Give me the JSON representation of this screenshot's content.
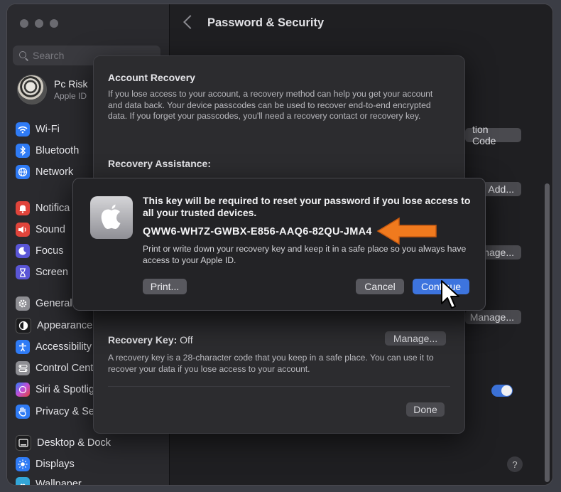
{
  "sidebar": {
    "search_placeholder": "Search",
    "account": {
      "name": "Pc Risk",
      "subtitle": "Apple ID"
    },
    "items": [
      {
        "label": "Wi-Fi",
        "icon": "wifi-icon",
        "color": "#2f7bf5"
      },
      {
        "label": "Bluetooth",
        "icon": "bluetooth-icon",
        "color": "#2f7bf5"
      },
      {
        "label": "Network",
        "icon": "network-icon",
        "color": "#2f7bf5"
      },
      {
        "label": "Notifica",
        "icon": "notifications-icon",
        "color": "#e0443b"
      },
      {
        "label": "Sound",
        "icon": "sound-icon",
        "color": "#e0443b"
      },
      {
        "label": "Focus",
        "icon": "focus-icon",
        "color": "#5a56d6"
      },
      {
        "label": "Screen",
        "icon": "screen-time-icon",
        "color": "#5a56d6"
      },
      {
        "label": "General",
        "icon": "general-icon",
        "color": "#8e8e93"
      },
      {
        "label": "Appearance",
        "icon": "appearance-icon",
        "color": "#1c1c1e"
      },
      {
        "label": "Accessibility",
        "icon": "accessibility-icon",
        "color": "#2f7bf5"
      },
      {
        "label": "Control Cent",
        "icon": "control-center-icon",
        "color": "#8e8e93"
      },
      {
        "label": "Siri & Spotlig",
        "icon": "siri-icon",
        "color": "#c04fd8"
      },
      {
        "label": "Privacy & Se",
        "icon": "privacy-icon",
        "color": "#2f7bf5"
      },
      {
        "label": "Desktop & Dock",
        "icon": "desktop-dock-icon",
        "color": "#1c1c1e"
      },
      {
        "label": "Displays",
        "icon": "displays-icon",
        "color": "#2f7bf5"
      },
      {
        "label": "Wallpaper",
        "icon": "wallpaper-icon",
        "color": "#33a6d8"
      }
    ]
  },
  "main": {
    "title": "Password & Security",
    "bg_buttons": [
      "tion Code",
      "Add...",
      "nage...",
      "Manage..."
    ],
    "help": "?"
  },
  "sheet": {
    "title": "Account Recovery",
    "description": "If you lose access to your account, a recovery method can help you get your account and data back. Your device passcodes can be used to recover end-to-end encrypted data. If you forget your passcodes, you'll need a recovery contact or recovery key.",
    "assistance_label": "Recovery Assistance:",
    "recovery_key_label": "Recovery Key:",
    "recovery_key_value": " Off",
    "recovery_key_desc": "A recovery key is a 28-character code that you keep in a safe place. You can use it to recover your data if you lose access to your account.",
    "manage_label": "Manage...",
    "done_label": "Done"
  },
  "dialog": {
    "title": "This key will be required to reset your password if you lose access to all your trusted devices.",
    "key": "QWW6-WH7Z-GWBX-E856-AAQ6-82QU-JMA4",
    "body": "Print or write down your recovery key and keep it in a safe place so you always have access to your Apple ID.",
    "print_label": "Print...",
    "cancel_label": "Cancel",
    "continue_label": "Continue"
  },
  "colors": {
    "accent": "#3d74de",
    "arrow": "#f07a1e"
  }
}
